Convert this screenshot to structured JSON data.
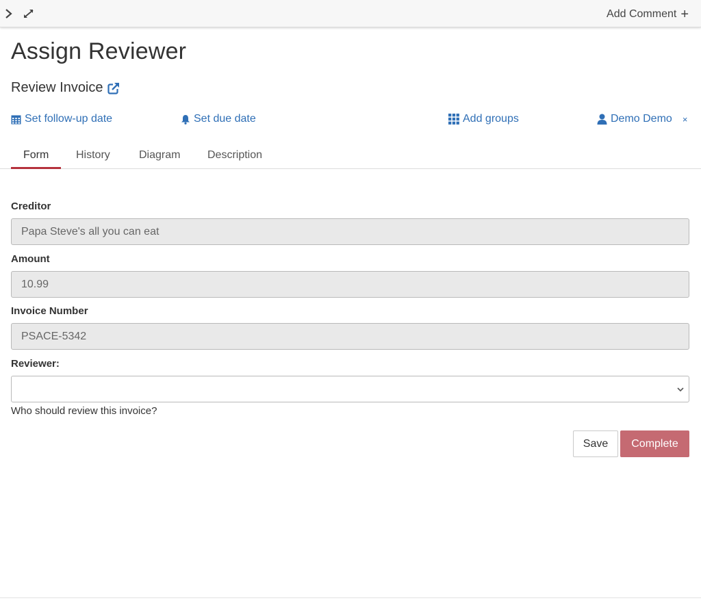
{
  "topbar": {
    "collapse_icon": "chevron-right-icon",
    "expand_icon": "expand-icon",
    "add_comment_label": "Add Comment",
    "add_comment_icon": "+"
  },
  "task": {
    "title": "Assign Reviewer",
    "process_name": "Review Invoice",
    "process_link_icon": "external-link-icon"
  },
  "actions": {
    "followup_label": "Set follow-up date",
    "due_label": "Set due date",
    "groups_label": "Add groups",
    "assignee_label": "Demo Demo",
    "remove_assignee_icon": "×"
  },
  "tabs": [
    {
      "label": "Form",
      "active": true
    },
    {
      "label": "History",
      "active": false
    },
    {
      "label": "Diagram",
      "active": false
    },
    {
      "label": "Description",
      "active": false
    }
  ],
  "form": {
    "creditor_label": "Creditor",
    "creditor_value": "Papa Steve's all you can eat",
    "amount_label": "Amount",
    "amount_value": "10.99",
    "invoice_number_label": "Invoice Number",
    "invoice_number_value": "PSACE-5342",
    "reviewer_label": "Reviewer:",
    "reviewer_value": "",
    "reviewer_help": "Who should review this invoice?"
  },
  "buttons": {
    "save_label": "Save",
    "complete_label": "Complete"
  },
  "colors": {
    "link": "#2f6fb6",
    "accent": "#b5323d",
    "complete_button": "#c56a72",
    "readonly_field": "#e9e9e9"
  }
}
